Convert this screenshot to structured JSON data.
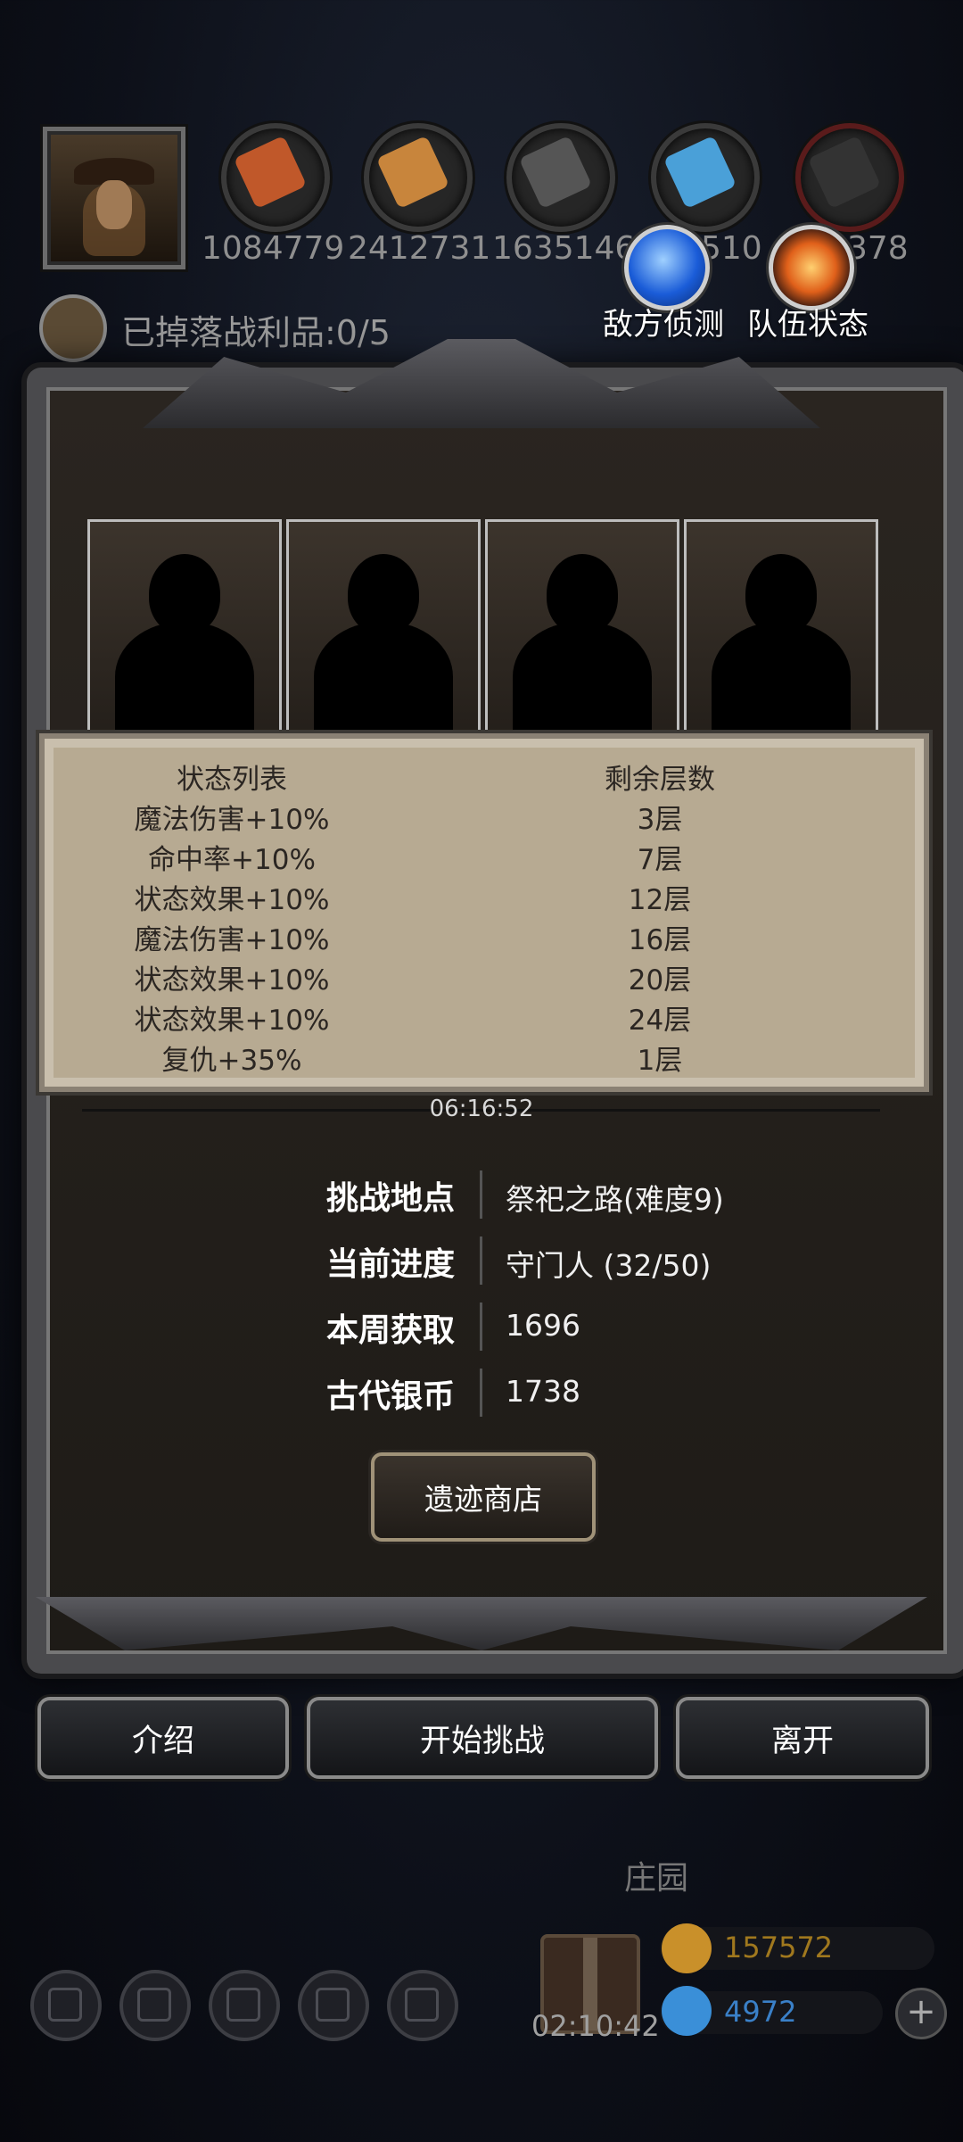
{
  "resources": {
    "values": [
      "1084779",
      "2412731",
      "1635146",
      "510",
      "378"
    ],
    "colors": [
      "#c0582a",
      "#c8853c",
      "#555555",
      "#4aa0d8",
      "#333333"
    ]
  },
  "scouting": {
    "label": "敌方侦测",
    "icon": "blue-orb-icon"
  },
  "team_status": {
    "label": "队伍状态",
    "icon": "fire-burst-icon"
  },
  "loot": {
    "text": "已掉落战利品:0/5"
  },
  "status_table": {
    "header": {
      "name": "状态列表",
      "layers": "剩余层数"
    },
    "rows": [
      {
        "name": "魔法伤害+10%",
        "layers": "3层"
      },
      {
        "name": "命中率+10%",
        "layers": "7层"
      },
      {
        "name": "状态效果+10%",
        "layers": "12层"
      },
      {
        "name": "魔法伤害+10%",
        "layers": "16层"
      },
      {
        "name": "状态效果+10%",
        "layers": "20层"
      },
      {
        "name": "状态效果+10%",
        "layers": "24层"
      },
      {
        "name": "复仇+35%",
        "layers": "1层"
      }
    ]
  },
  "timer": "06:16:52",
  "info": [
    {
      "label": "挑战地点",
      "value": "祭祀之路(难度9)"
    },
    {
      "label": "当前进度",
      "value": "守门人 (32/50)"
    },
    {
      "label": "本周获取",
      "value": "1696"
    },
    {
      "label": "古代银币",
      "value": "1738"
    }
  ],
  "shop_button": "遗迹商店",
  "actions": {
    "intro": "介绍",
    "start": "开始挑战",
    "leave": "离开"
  },
  "estate": "庄园",
  "gift_timer": "02:10:42",
  "currency": {
    "gold": {
      "value": "157572",
      "color": "#c9902a"
    },
    "gems": {
      "value": "4972",
      "color": "#3a8fd8"
    }
  }
}
